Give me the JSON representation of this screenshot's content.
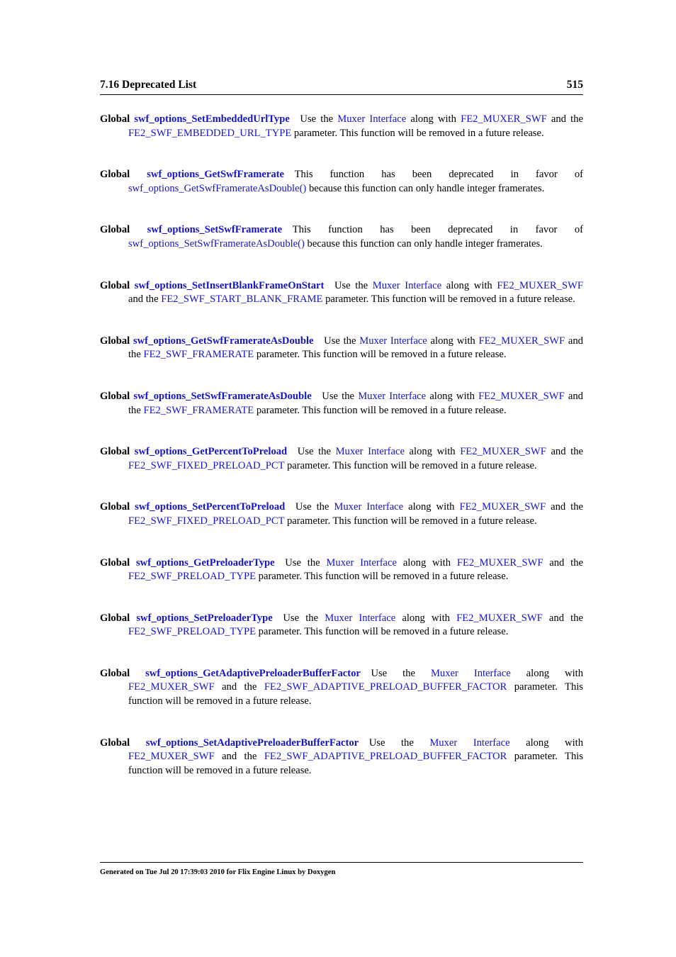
{
  "header": {
    "section_title": "7.16 Deprecated List",
    "page_number": "515"
  },
  "colors": {
    "link": "#1414cc",
    "text": "#000000",
    "background": "#ffffff"
  },
  "entries": [
    {
      "kind": "Global",
      "function": "swf_options_SetEmbeddedUrlType",
      "body": [
        {
          "t": "Use the ",
          "style": "plain"
        },
        {
          "t": "Muxer Interface",
          "style": "link"
        },
        {
          "t": " along with ",
          "style": "plain"
        },
        {
          "t": "FE2_MUXER_SWF",
          "style": "link"
        },
        {
          "t": " and the ",
          "style": "plain"
        },
        {
          "t": "FE2_SWF_EMBEDDED_URL_TYPE",
          "style": "link"
        },
        {
          "t": " parameter. This function will be removed in a future release.",
          "style": "plain"
        }
      ]
    },
    {
      "kind": "Global",
      "function": "swf_options_GetSwfFramerate",
      "body": [
        {
          "t": "This function has been deprecated in favor of ",
          "style": "plain"
        },
        {
          "t": "swf_options_GetSwfFramerateAsDouble()",
          "style": "link"
        },
        {
          "t": " because this function can only handle integer framerates.",
          "style": "plain"
        }
      ]
    },
    {
      "kind": "Global",
      "function": "swf_options_SetSwfFramerate",
      "body": [
        {
          "t": "This function has been deprecated in favor of ",
          "style": "plain"
        },
        {
          "t": "swf_options_SetSwfFramerateAsDouble()",
          "style": "link"
        },
        {
          "t": " because this function can only handle integer framerates.",
          "style": "plain"
        }
      ]
    },
    {
      "kind": "Global",
      "function": "swf_options_SetInsertBlankFrameOnStart",
      "body": [
        {
          "t": "Use the ",
          "style": "plain"
        },
        {
          "t": "Muxer Interface",
          "style": "link"
        },
        {
          "t": " along with ",
          "style": "plain"
        },
        {
          "t": "FE2_MUXER_SWF",
          "style": "link"
        },
        {
          "t": " and the ",
          "style": "plain"
        },
        {
          "t": "FE2_SWF_START_BLANK_FRAME",
          "style": "link"
        },
        {
          "t": " parameter. This function will be removed in a future release.",
          "style": "plain"
        }
      ]
    },
    {
      "kind": "Global",
      "function": "swf_options_GetSwfFramerateAsDouble",
      "body": [
        {
          "t": "Use the ",
          "style": "plain"
        },
        {
          "t": "Muxer Interface",
          "style": "link"
        },
        {
          "t": " along with ",
          "style": "plain"
        },
        {
          "t": "FE2_MUXER_SWF",
          "style": "link"
        },
        {
          "t": " and the ",
          "style": "plain"
        },
        {
          "t": "FE2_SWF_FRAMERATE",
          "style": "link"
        },
        {
          "t": " parameter. This function will be removed in a future release.",
          "style": "plain"
        }
      ]
    },
    {
      "kind": "Global",
      "function": "swf_options_SetSwfFramerateAsDouble",
      "body": [
        {
          "t": "Use the ",
          "style": "plain"
        },
        {
          "t": "Muxer Interface",
          "style": "link"
        },
        {
          "t": " along with ",
          "style": "plain"
        },
        {
          "t": "FE2_MUXER_SWF",
          "style": "link"
        },
        {
          "t": " and the ",
          "style": "plain"
        },
        {
          "t": "FE2_SWF_FRAMERATE",
          "style": "link"
        },
        {
          "t": " parameter. This function will be removed in a future release.",
          "style": "plain"
        }
      ]
    },
    {
      "kind": "Global",
      "function": "swf_options_GetPercentToPreload",
      "body": [
        {
          "t": "Use the ",
          "style": "plain"
        },
        {
          "t": "Muxer Interface",
          "style": "link"
        },
        {
          "t": " along with ",
          "style": "plain"
        },
        {
          "t": "FE2_MUXER_SWF",
          "style": "link"
        },
        {
          "t": " and the ",
          "style": "plain"
        },
        {
          "t": "FE2_SWF_FIXED_PRELOAD_PCT",
          "style": "link"
        },
        {
          "t": " parameter. This function will be removed in a future release.",
          "style": "plain"
        }
      ]
    },
    {
      "kind": "Global",
      "function": "swf_options_SetPercentToPreload",
      "body": [
        {
          "t": "Use the ",
          "style": "plain"
        },
        {
          "t": "Muxer Interface",
          "style": "link"
        },
        {
          "t": " along with ",
          "style": "plain"
        },
        {
          "t": "FE2_MUXER_SWF",
          "style": "link"
        },
        {
          "t": " and the ",
          "style": "plain"
        },
        {
          "t": "FE2_SWF_FIXED_PRELOAD_PCT",
          "style": "link"
        },
        {
          "t": " parameter. This function will be removed in a future release.",
          "style": "plain"
        }
      ]
    },
    {
      "kind": "Global",
      "function": "swf_options_GetPreloaderType",
      "body": [
        {
          "t": "Use the ",
          "style": "plain"
        },
        {
          "t": "Muxer Interface",
          "style": "link"
        },
        {
          "t": " along with ",
          "style": "plain"
        },
        {
          "t": "FE2_MUXER_SWF",
          "style": "link"
        },
        {
          "t": " and the ",
          "style": "plain"
        },
        {
          "t": "FE2_SWF_PRELOAD_TYPE",
          "style": "link"
        },
        {
          "t": " parameter. This function will be removed in a future release.",
          "style": "plain"
        }
      ]
    },
    {
      "kind": "Global",
      "function": "swf_options_SetPreloaderType",
      "body": [
        {
          "t": "Use the ",
          "style": "plain"
        },
        {
          "t": "Muxer Interface",
          "style": "link"
        },
        {
          "t": " along with ",
          "style": "plain"
        },
        {
          "t": "FE2_MUXER_SWF",
          "style": "link"
        },
        {
          "t": " and the ",
          "style": "plain"
        },
        {
          "t": "FE2_SWF_PRELOAD_TYPE",
          "style": "link"
        },
        {
          "t": " parameter. This function will be removed in a future release.",
          "style": "plain"
        }
      ]
    },
    {
      "kind": "Global",
      "function": "swf_options_GetAdaptivePreloaderBufferFactor",
      "body": [
        {
          "t": "Use the ",
          "style": "plain"
        },
        {
          "t": "Muxer Interface",
          "style": "link"
        },
        {
          "t": " along with ",
          "style": "plain"
        },
        {
          "t": "FE2_MUXER_SWF",
          "style": "link"
        },
        {
          "t": " and the ",
          "style": "plain"
        },
        {
          "t": "FE2_SWF_ADAPTIVE_PRELOAD_BUFFER_FACTOR",
          "style": "link"
        },
        {
          "t": " parameter. This function will be removed in a future release.",
          "style": "plain"
        }
      ]
    },
    {
      "kind": "Global",
      "function": "swf_options_SetAdaptivePreloaderBufferFactor",
      "body": [
        {
          "t": "Use the ",
          "style": "plain"
        },
        {
          "t": "Muxer Interface",
          "style": "link"
        },
        {
          "t": " along with ",
          "style": "plain"
        },
        {
          "t": "FE2_MUXER_SWF",
          "style": "link"
        },
        {
          "t": " and the ",
          "style": "plain"
        },
        {
          "t": "FE2_SWF_ADAPTIVE_PRELOAD_BUFFER_FACTOR",
          "style": "link"
        },
        {
          "t": " parameter. This function will be removed in a future release.",
          "style": "plain"
        }
      ]
    }
  ],
  "footer": {
    "text": "Generated on Tue Jul 20 17:39:03 2010 for Flix Engine Linux by Doxygen"
  }
}
